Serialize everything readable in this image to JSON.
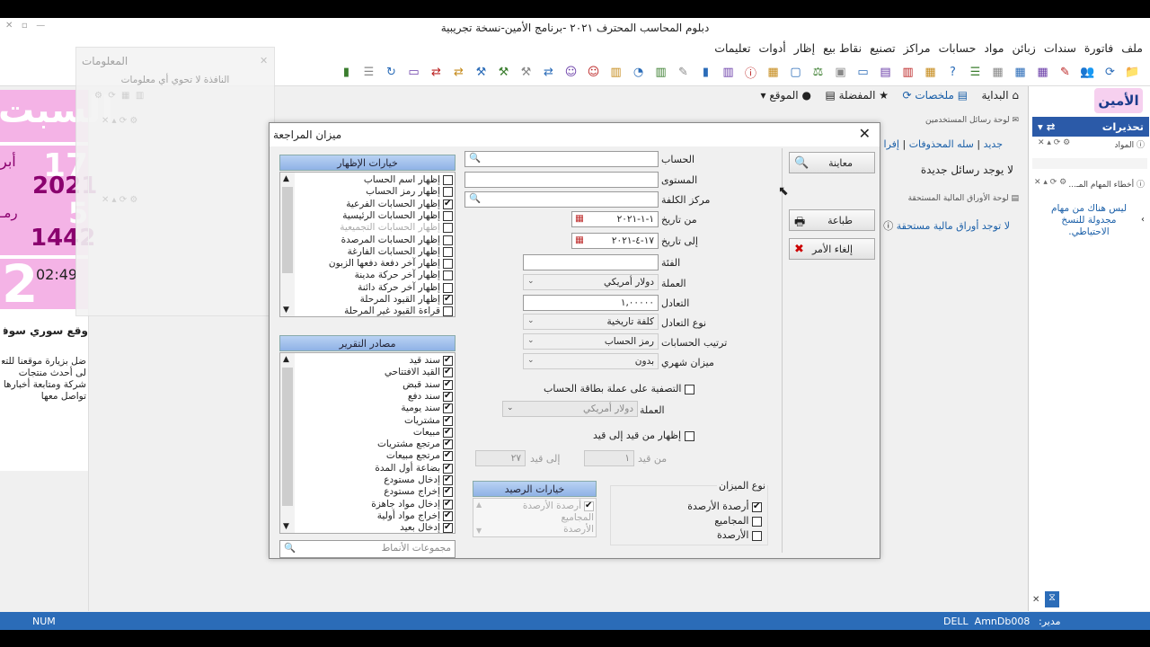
{
  "window": {
    "title": "دبلوم المحاسب المحترف ٢٠٢١ -برنامج الأمين-نسخة تجريبية"
  },
  "menu": [
    "ملف",
    "فاتورة",
    "سندات",
    "زبائن",
    "مواد",
    "حسابات",
    "مراكز",
    "تصنيع",
    "نقاط بيع",
    "إظار",
    "أدوات",
    "تعليمات"
  ],
  "toolbar_icons": [
    "folder-icon",
    "refresh-icon",
    "users-icon",
    "edit-icon",
    "calendar-icon",
    "calendar-icon",
    "calendar-icon",
    "list-icon",
    "help-icon",
    "grid-icon",
    "chart-icon",
    "excel-icon",
    "doc-icon",
    "db-icon",
    "scale-icon",
    "box-icon",
    "calc-icon",
    "info-icon",
    "chart-icon",
    "book-icon",
    "edit-icon",
    "chart-icon",
    "pie-icon",
    "barcode-icon",
    "people-icon",
    "people-icon",
    "arrows-icon",
    "tool-icon",
    "tool-icon",
    "tool-icon",
    "arrows-icon",
    "arrows-icon",
    "doc-icon",
    "sync-icon",
    "list-icon",
    "book-icon"
  ],
  "tabs": [
    "البداية",
    "ملخصات",
    "المفضلة",
    "الموقع"
  ],
  "left": {
    "day": "السبت",
    "num1": "17",
    "month1": "أبر",
    "year1": "2021",
    "month2": "رمـ",
    "num2": "5",
    "year2": "1442",
    "time": "02:49",
    "num3": "2",
    "site_title": "وقع سوري سوفت",
    "site_text": [
      "ضل بزيارة موقعنا للتعر",
      "لى أحدث منتجات",
      "شركة ومتابعة أخبارها",
      "تواصل معها"
    ]
  },
  "info_panel": {
    "title": "المعلومات",
    "empty": "النافذة لا تحوي أي معلومات"
  },
  "messages": {
    "header": "لوحة رسائل المستخدمين",
    "links": [
      "جديد",
      "سله المحذوفات",
      "إفرا"
    ],
    "empty": "لا يوجد رسائل جديدة",
    "papers_header": "لوحة الأوراق المالية المستحقة",
    "papers_empty": "لا توجد أوراق مالية مستحقة"
  },
  "right_panel": {
    "title": "تحذيرات",
    "section1": "المواد",
    "section2": "أخطاء المهام المـ...",
    "task_note": "ليس هناك من مهام مجدولة للنسخ الاحتياطي."
  },
  "dialog": {
    "title": "ميزان المراجعة",
    "display_options_title": "خيارات الإظهار",
    "display_options": [
      {
        "label": "إظهار اسم الحساب",
        "checked": false,
        "disabled": false
      },
      {
        "label": "إظهار رمز الحساب",
        "checked": false,
        "disabled": false
      },
      {
        "label": "إظهار الحسابات الفرعية",
        "checked": true,
        "disabled": false
      },
      {
        "label": "إظهار الحسابات الرئيسية",
        "checked": false,
        "disabled": false
      },
      {
        "label": "إظهار الحسابات التجميعية",
        "checked": false,
        "disabled": true
      },
      {
        "label": "إظهار الحسابات المرصدة",
        "checked": false,
        "disabled": false
      },
      {
        "label": "إظهار الحسابات الفارغة",
        "checked": false,
        "disabled": false
      },
      {
        "label": "إظهار آخر دفعة دفعها الزبون",
        "checked": false,
        "disabled": false
      },
      {
        "label": "إظهار آخر حركة مدينة",
        "checked": false,
        "disabled": false
      },
      {
        "label": "إظهار آخر حركة دائنة",
        "checked": false,
        "disabled": false
      },
      {
        "label": "إظهار القيود المرحلة",
        "checked": true,
        "disabled": false
      },
      {
        "label": "قراءة القيود غير المرحلة",
        "checked": false,
        "disabled": false
      }
    ],
    "sources_title": "مصادر التقرير",
    "sources": [
      {
        "label": "سند قيد",
        "checked": true
      },
      {
        "label": "القيد الافتتاحي",
        "checked": true
      },
      {
        "label": "سند قبض",
        "checked": true
      },
      {
        "label": "سند دفع",
        "checked": true
      },
      {
        "label": "سند يومية",
        "checked": true
      },
      {
        "label": "مشتريات",
        "checked": true
      },
      {
        "label": "مبيعات",
        "checked": true
      },
      {
        "label": "مرتجع مشتريات",
        "checked": true
      },
      {
        "label": "مرتجع مبيعات",
        "checked": true
      },
      {
        "label": "بضاعة أول المدة",
        "checked": true
      },
      {
        "label": "إدخال مستودع",
        "checked": true
      },
      {
        "label": "إخراج مستودع",
        "checked": true
      },
      {
        "label": "إدخال مواد جاهزة",
        "checked": true
      },
      {
        "label": "إخراج مواد أولية",
        "checked": true
      },
      {
        "label": "إدخال بعيد",
        "checked": true
      }
    ],
    "patterns_placeholder": "مجموعات الأنماط",
    "account_label": "الحساب",
    "level_label": "المستوى",
    "cost_center_label": "مركز الكلفة",
    "from_date_label": "من تاريخ",
    "from_date": "١-١-٢٠٢١",
    "to_date_label": "إلى تاريخ",
    "to_date": "١٧-٤-٢٠٢١",
    "category_label": "الفئة",
    "currency_label": "العملة",
    "currency": "دولار أمريكي",
    "rate_label": "التعادل",
    "rate": "١,٠٠٠٠٠",
    "rate_type_label": "نوع التعادل",
    "rate_type": "كلفة تاريخية",
    "sort_label": "ترتيب الحسابات",
    "sort": "رمز الحساب",
    "monthly_label": "ميزان شهري",
    "monthly": "بدون",
    "filter_currency_label": "التصفية على عملة بطاقة الحساب",
    "currency2_label": "العملة",
    "currency2": "دولار أمريكي",
    "show_range_label": "إظهار من قيد إلى قيد",
    "from_entry_label": "من قيد",
    "from_entry": "١",
    "to_entry_label": "إلى قيد",
    "to_entry": "٢٧",
    "balance_options_title": "خيارات الرصيد",
    "balance_options": [
      "أرصدة الأرصدة",
      "المجاميع",
      "الأرصدة"
    ],
    "trial_type_title": "نوع الميزان",
    "trial_types": [
      {
        "label": "أرصدة الأرصدة",
        "checked": true
      },
      {
        "label": "المجاميع",
        "checked": false
      },
      {
        "label": "الأرصدة",
        "checked": false
      }
    ],
    "buttons": {
      "preview": "معاينة",
      "print": "طباعة",
      "cancel": "إلغاء الأمر"
    }
  },
  "status": {
    "left": "NUM",
    "db": "DELL  AmnDb008",
    "user": "مدير:"
  },
  "colors": {
    "accent": "#2b6cb8",
    "pink": "#f4b3e6",
    "magenta": "#b0008a",
    "group_header": "#9dbbe9"
  }
}
